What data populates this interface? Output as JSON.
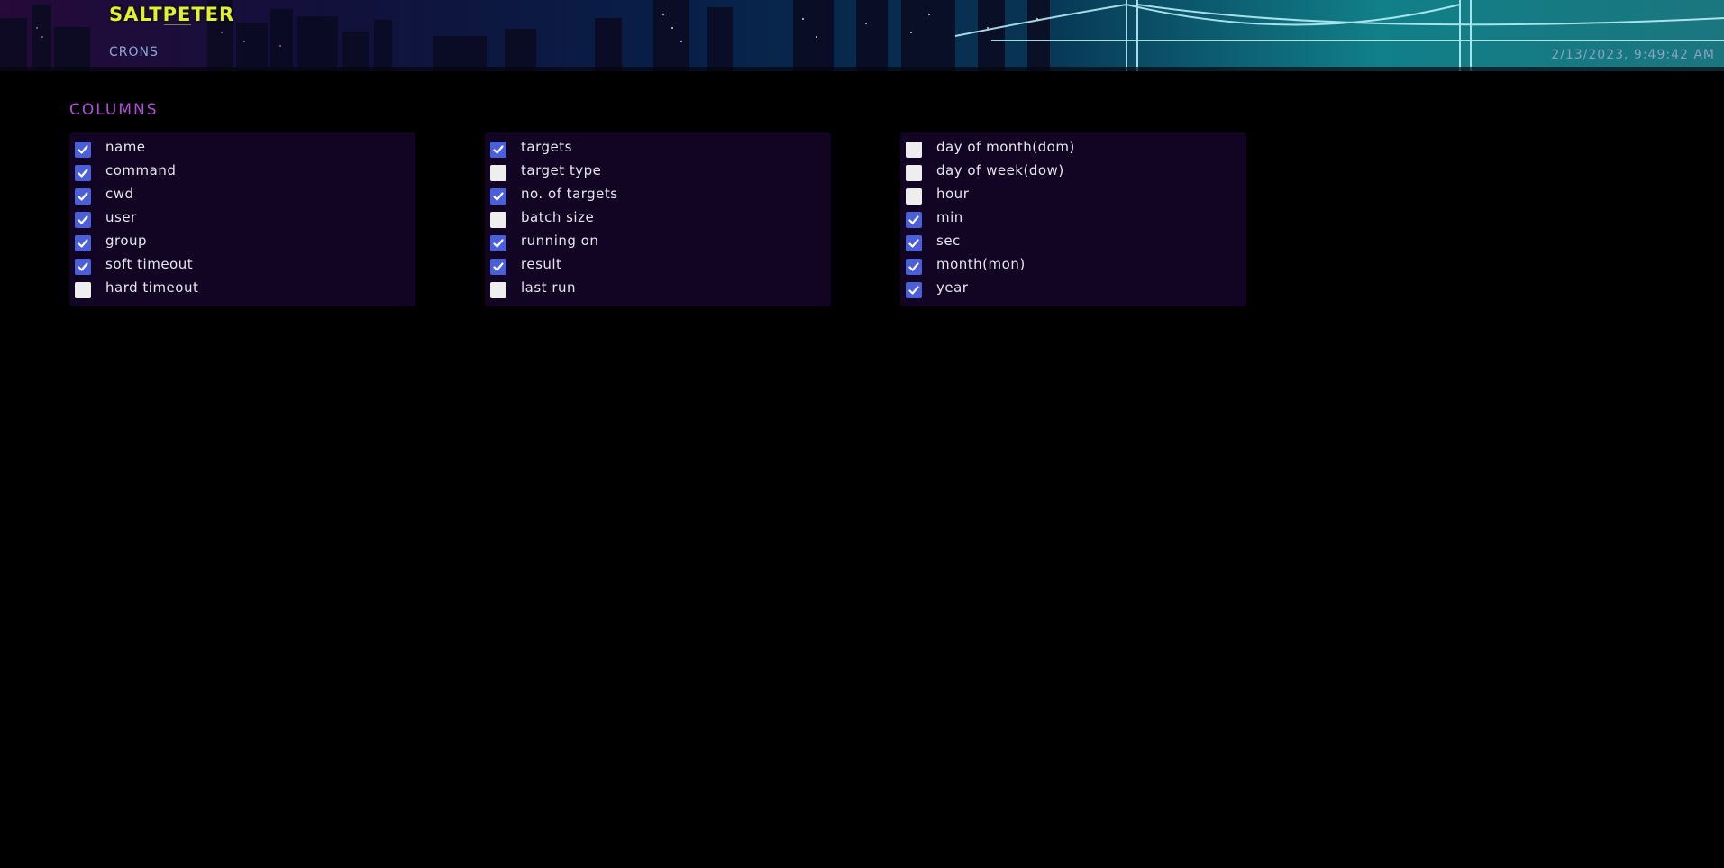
{
  "header": {
    "logo": "SALTPETER",
    "nav_crons": "CRONS",
    "clock": "2/13/2023, 9:49:42 AM"
  },
  "section": {
    "title": "COLUMNS"
  },
  "columns": [
    {
      "items": [
        {
          "label": "name",
          "checked": true
        },
        {
          "label": "command",
          "checked": true
        },
        {
          "label": "cwd",
          "checked": true
        },
        {
          "label": "user",
          "checked": true
        },
        {
          "label": "group",
          "checked": true
        },
        {
          "label": "soft timeout",
          "checked": true
        },
        {
          "label": "hard timeout",
          "checked": false
        }
      ]
    },
    {
      "items": [
        {
          "label": "targets",
          "checked": true
        },
        {
          "label": "target type",
          "checked": false
        },
        {
          "label": "no. of targets",
          "checked": true
        },
        {
          "label": "batch size",
          "checked": false
        },
        {
          "label": "running on",
          "checked": true
        },
        {
          "label": "result",
          "checked": true
        },
        {
          "label": "last run",
          "checked": false
        }
      ]
    },
    {
      "items": [
        {
          "label": "day of month(dom)",
          "checked": false
        },
        {
          "label": "day of week(dow)",
          "checked": false
        },
        {
          "label": "hour",
          "checked": false
        },
        {
          "label": "min",
          "checked": true
        },
        {
          "label": "sec",
          "checked": true
        },
        {
          "label": "month(mon)",
          "checked": true
        },
        {
          "label": "year",
          "checked": true
        }
      ]
    }
  ],
  "colors": {
    "accent": "#b04fd8",
    "logo": "#e0f22a",
    "checkbox_checked": "#4a5fd8",
    "panel_bg": "#120523"
  }
}
